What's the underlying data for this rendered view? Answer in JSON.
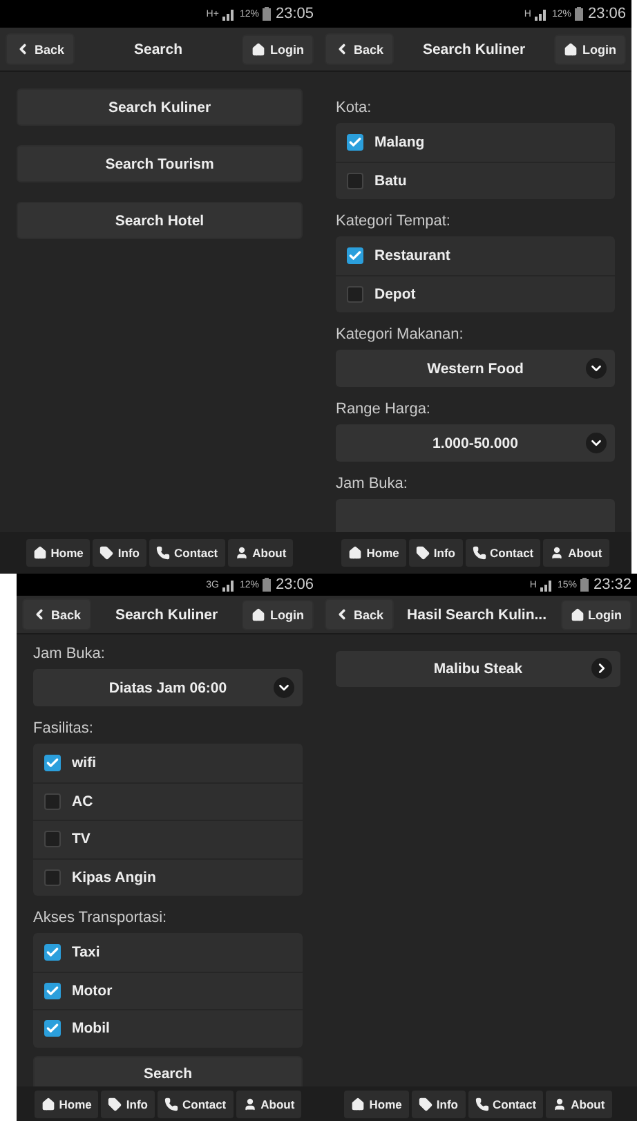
{
  "screens": [
    {
      "status": {
        "network": "H+",
        "battery": "12%",
        "time": "23:05"
      },
      "header": {
        "back": "Back",
        "title": "Search",
        "login": "Login"
      },
      "content": [
        {
          "kind": "button",
          "label": "Search Kuliner"
        },
        {
          "kind": "button",
          "label": "Search Tourism"
        },
        {
          "kind": "button",
          "label": "Search Hotel"
        }
      ],
      "footer": [
        {
          "label": "Home"
        },
        {
          "label": "Info"
        },
        {
          "label": "Contact"
        },
        {
          "label": "About"
        }
      ]
    },
    {
      "status": {
        "network": "H",
        "battery": "12%",
        "time": "23:06"
      },
      "header": {
        "back": "Back",
        "title": "Search Kuliner",
        "login": "Login"
      },
      "content": [
        {
          "kind": "label",
          "text": "Kota:"
        },
        {
          "kind": "checkgroup",
          "options": [
            {
              "label": "Malang",
              "checked": true
            },
            {
              "label": "Batu",
              "checked": false
            }
          ]
        },
        {
          "kind": "label",
          "text": "Kategori Tempat:"
        },
        {
          "kind": "checkgroup",
          "options": [
            {
              "label": "Restaurant",
              "checked": true
            },
            {
              "label": "Depot",
              "checked": false
            }
          ]
        },
        {
          "kind": "label",
          "text": "Kategori Makanan:"
        },
        {
          "kind": "select",
          "value": "Western Food"
        },
        {
          "kind": "label",
          "text": "Range Harga:"
        },
        {
          "kind": "select",
          "value": "1.000-50.000"
        },
        {
          "kind": "label",
          "text": "Jam Buka:"
        },
        {
          "kind": "select"
        }
      ],
      "footer": [
        {
          "label": "Home"
        },
        {
          "label": "Info"
        },
        {
          "label": "Contact"
        },
        {
          "label": "About"
        }
      ]
    },
    {
      "status": {
        "network": "3G",
        "battery": "12%",
        "time": "23:06"
      },
      "header": {
        "back": "Back",
        "title": "Search Kuliner",
        "login": "Login"
      },
      "content": [
        {
          "kind": "label",
          "text": "Jam Buka:"
        },
        {
          "kind": "select",
          "value": "Diatas Jam 06:00"
        },
        {
          "kind": "label",
          "text": "Fasilitas:"
        },
        {
          "kind": "checkgroup",
          "options": [
            {
              "label": "wifi",
              "checked": true
            },
            {
              "label": "AC",
              "checked": false
            },
            {
              "label": "TV",
              "checked": false
            },
            {
              "label": "Kipas Angin",
              "checked": false
            }
          ]
        },
        {
          "kind": "label",
          "text": "Akses Transportasi:"
        },
        {
          "kind": "checkgroup",
          "options": [
            {
              "label": "Taxi",
              "checked": true
            },
            {
              "label": "Motor",
              "checked": true
            },
            {
              "label": "Mobil",
              "checked": true
            }
          ]
        },
        {
          "kind": "button",
          "label": "Search"
        }
      ],
      "footer": [
        {
          "label": "Home"
        },
        {
          "label": "Info"
        },
        {
          "label": "Contact"
        },
        {
          "label": "About"
        }
      ]
    },
    {
      "status": {
        "network": "H",
        "battery": "15%",
        "time": "23:32"
      },
      "header": {
        "back": "Back",
        "title": "Hasil Search Kulin...",
        "login": "Login"
      },
      "content": [
        {
          "kind": "listitem",
          "label": "Malibu Steak"
        }
      ],
      "footer": [
        {
          "label": "Home"
        },
        {
          "label": "Info"
        },
        {
          "label": "Contact"
        },
        {
          "label": "About"
        }
      ]
    }
  ]
}
